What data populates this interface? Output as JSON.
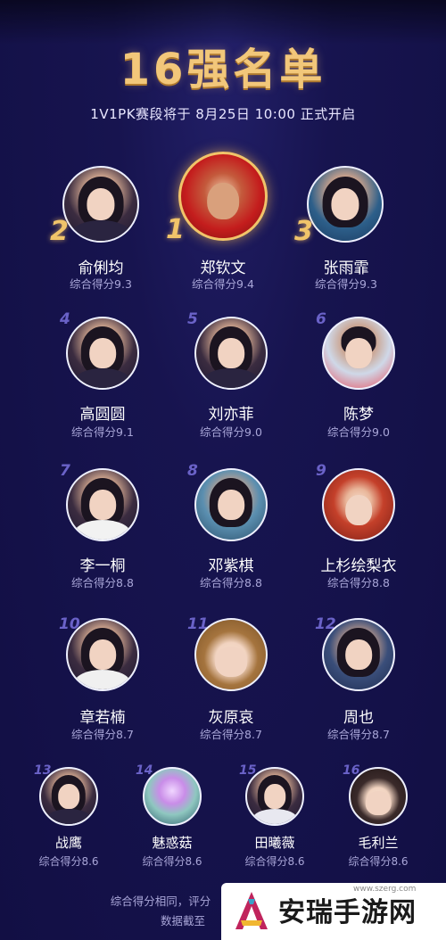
{
  "header": {
    "title": "16强名单",
    "subtitle": "1V1PK赛段将于 8月25日 10:00 正式开启"
  },
  "top3": [
    {
      "rank": "2",
      "name": "俞俐均",
      "score": "综合得分9.3"
    },
    {
      "rank": "1",
      "name": "郑钦文",
      "score": "综合得分9.4"
    },
    {
      "rank": "3",
      "name": "张雨霏",
      "score": "综合得分9.3"
    }
  ],
  "row2": [
    {
      "rank": "4",
      "name": "高圆圆",
      "score": "综合得分9.1"
    },
    {
      "rank": "5",
      "name": "刘亦菲",
      "score": "综合得分9.0"
    },
    {
      "rank": "6",
      "name": "陈梦",
      "score": "综合得分9.0"
    }
  ],
  "row3": [
    {
      "rank": "7",
      "name": "李一桐",
      "score": "综合得分8.8"
    },
    {
      "rank": "8",
      "name": "邓紫棋",
      "score": "综合得分8.8"
    },
    {
      "rank": "9",
      "name": "上杉绘梨衣",
      "score": "综合得分8.8"
    }
  ],
  "row4": [
    {
      "rank": "10",
      "name": "章若楠",
      "score": "综合得分8.7"
    },
    {
      "rank": "11",
      "name": "灰原哀",
      "score": "综合得分8.7"
    },
    {
      "rank": "12",
      "name": "周也",
      "score": "综合得分8.7"
    }
  ],
  "row5": [
    {
      "rank": "13",
      "name": "战鹰",
      "score": "综合得分8.6"
    },
    {
      "rank": "14",
      "name": "魅惑菇",
      "score": "综合得分8.6"
    },
    {
      "rank": "15",
      "name": "田曦薇",
      "score": "综合得分8.6"
    },
    {
      "rank": "16",
      "name": "毛利兰",
      "score": "综合得分8.6"
    }
  ],
  "footer": {
    "line1": "综合得分相同，评分",
    "line2": "数据截至"
  },
  "watermark": {
    "text": "安瑞手游网",
    "url": "www.szerg.com"
  },
  "colors": {
    "background": "#17144f",
    "title_gold": "#f2c77a",
    "rank_purple": "#6a62c8",
    "score_gray": "#a9a6d8"
  }
}
